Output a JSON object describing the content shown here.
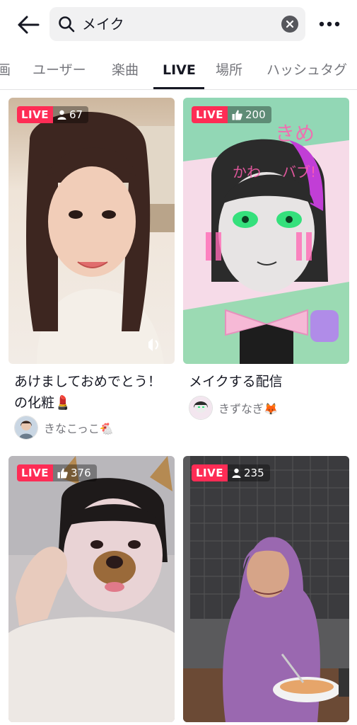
{
  "search": {
    "query": "メイク"
  },
  "tabs": [
    {
      "label": "画",
      "active": false
    },
    {
      "label": "ユーザー",
      "active": false
    },
    {
      "label": "楽曲",
      "active": false
    },
    {
      "label": "LIVE",
      "active": true
    },
    {
      "label": "場所",
      "active": false
    },
    {
      "label": "ハッシュタグ",
      "active": false
    }
  ],
  "cards": [
    {
      "live_label": "LIVE",
      "count": "67",
      "count_icon": "person-icon",
      "title": "あけましておめでとう！の化粧💄",
      "author": "きなこっこ🐔"
    },
    {
      "live_label": "LIVE",
      "count": "200",
      "count_icon": "thumbs-up-icon",
      "title": "メイクする配信",
      "author": "きずなぎ🦊"
    },
    {
      "live_label": "LIVE",
      "count": "376",
      "count_icon": "thumbs-up-icon",
      "title": "",
      "author": ""
    },
    {
      "live_label": "LIVE",
      "count": "235",
      "count_icon": "person-icon",
      "title": "",
      "author": ""
    }
  ],
  "colors": {
    "live": "#fe2c55",
    "active_tab": "#161823",
    "inactive_tab": "#75767c"
  }
}
